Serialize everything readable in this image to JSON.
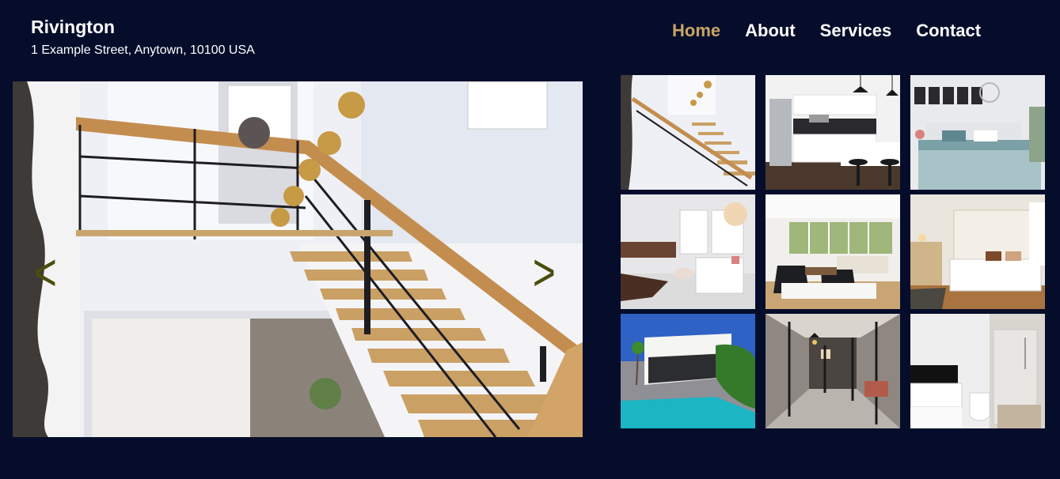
{
  "site": {
    "name": "Rivington",
    "address": "1 Example Street, Anytown, 10100 USA"
  },
  "nav": {
    "items": [
      {
        "label": "Home",
        "active": true
      },
      {
        "label": "About",
        "active": false
      },
      {
        "label": "Services",
        "active": false
      },
      {
        "label": "Contact",
        "active": false
      }
    ]
  },
  "colors": {
    "background": "#050d2b",
    "nav_active": "#c9a565",
    "nav_text": "#ffffff",
    "arrow": "#4a4d0d"
  },
  "hero": {
    "image": "staircase-photo",
    "prev_label": "<",
    "next_label": ">"
  },
  "gallery": {
    "thumbnails": [
      "staircase-thumbnail",
      "kitchen-thumbnail",
      "bedroom-thumbnail",
      "bathroom-lounge-thumbnail",
      "living-room-thumbnail",
      "master-bedroom-thumbnail",
      "pool-house-thumbnail",
      "glass-corridor-thumbnail",
      "shower-bathroom-thumbnail"
    ]
  }
}
